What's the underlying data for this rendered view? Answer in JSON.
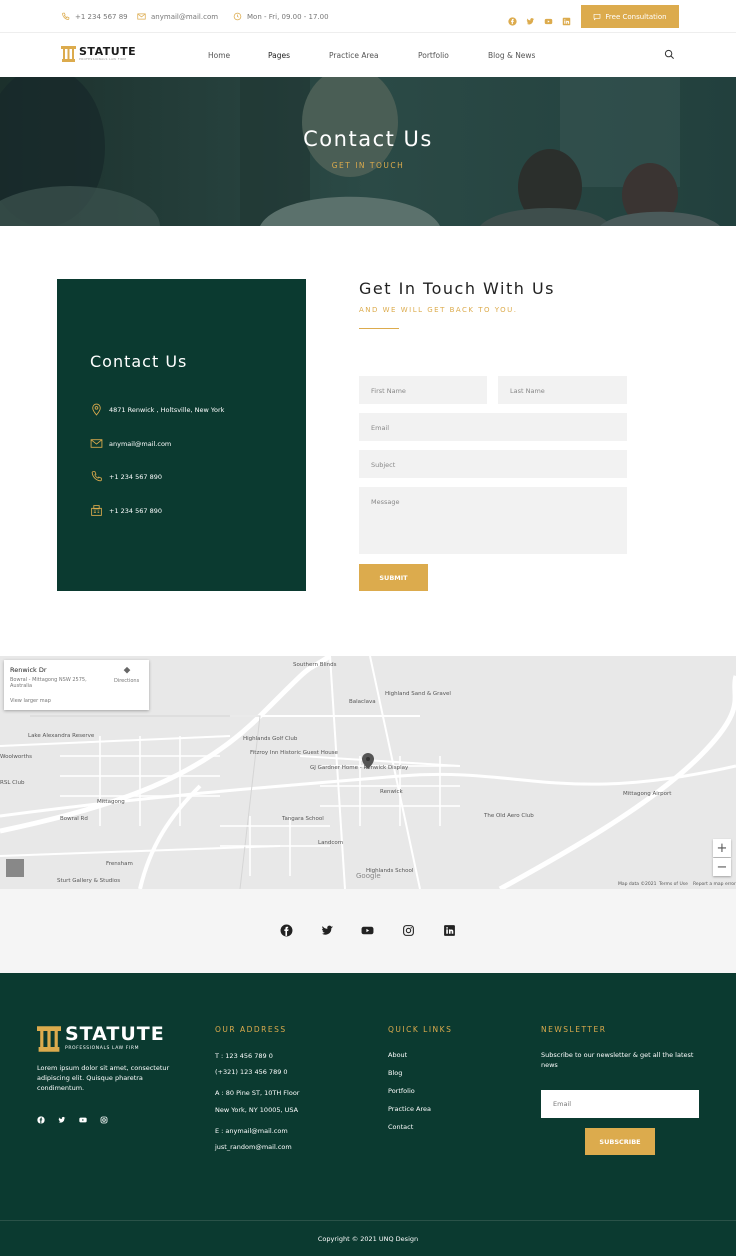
{
  "topbar": {
    "phone": "+1 234 567 89",
    "email": "anymail@mail.com",
    "hours": "Mon - Fri, 09.00 - 17.00",
    "cta_label": "Free Consultation"
  },
  "nav": {
    "logo_name": "STATUTE",
    "logo_tagline": "PROFESSIONALS LAW FIRM",
    "items": [
      "Home",
      "Pages",
      "Practice Area",
      "Portfolio",
      "Blog & News"
    ]
  },
  "hero": {
    "title": "Contact Us",
    "subtitle": "GET IN TOUCH"
  },
  "contact_card": {
    "title": "Contact Us",
    "address": "4871 Renwick , Holtsville, New York",
    "email": "anymail@mail.com",
    "phone": "+1 234 567 890",
    "fax": "+1 234 567 890"
  },
  "form": {
    "title": "Get In Touch With Us",
    "subtitle": "AND WE WILL GET BACK TO YOU.",
    "first_name": "First Name",
    "last_name": "Last Name",
    "email": "Email",
    "subject": "Subject",
    "message": "Message",
    "submit": "SUBMIT"
  },
  "map": {
    "place_title": "Renwick Dr",
    "place_address": "Bowral - Mittagong NSW 2575, Australia",
    "directions": "Directions",
    "view_larger": "View larger map",
    "labels": [
      "Southern Blinds",
      "Highland Sand & Gravel",
      "Balaclava",
      "Lake Alexandra Reserve",
      "Highlands Golf Club",
      "Fitzroy Inn Historic Guest House",
      "GJ Gardner Home - Renwick Display",
      "Woolworths",
      "RSL Club",
      "Mittagong",
      "Renwick",
      "Tangara School",
      "Landcom",
      "Highlands School",
      "Frensham",
      "Sturt Gallery & Studios",
      "Mittagong Airport",
      "The Old Aero Club",
      "Bowral Rd"
    ],
    "footer": [
      "Map data ©2021",
      "Terms of Use",
      "Report a map error"
    ],
    "zoom_in": "+",
    "zoom_out": "−"
  },
  "footer": {
    "logo_name": "STATUTE",
    "logo_tagline": "PROFESSIONALS LAW FIRM",
    "about": "Lorem ipsum dolor sit amet, consectetur adipiscing elit. Quisque pharetra condimentum.",
    "address_title": "OUR ADDRESS",
    "address_lines": [
      "T : 123 456 789 0",
      "(+321) 123 456 789 0",
      "A : 80 Pine ST, 10TH Floor",
      "New York, NY 10005, USA",
      "E : anymail@mail.com",
      "just_random@mail.com"
    ],
    "links_title": "QUICK LINKS",
    "links": [
      "About",
      "Blog",
      "Portfolio",
      "Practice Area",
      "Contact"
    ],
    "newsletter_title": "NEWSLETTER",
    "newsletter_text": "Subscribe to our newsletter & get all the latest news",
    "newsletter_placeholder": "Email",
    "subscribe": "SUBSCRIBE",
    "copyright": "Copyright © 2021 UNQ Design"
  },
  "colors": {
    "gold": "#dcab4d",
    "dark_green": "#0b3a30"
  }
}
